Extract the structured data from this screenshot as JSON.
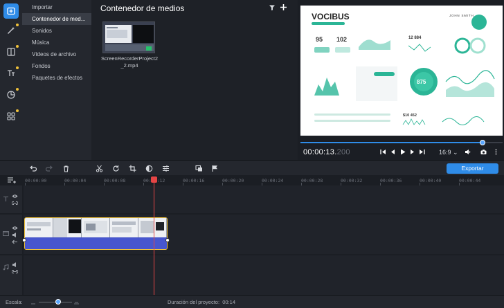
{
  "sidebar": {
    "tools": [
      {
        "name": "import-icon",
        "active": true,
        "dot": false
      },
      {
        "name": "magic-wand-icon",
        "active": false,
        "dot": true
      },
      {
        "name": "transitions-icon",
        "active": false,
        "dot": true
      },
      {
        "name": "titles-icon",
        "active": false,
        "dot": true
      },
      {
        "name": "stickers-icon",
        "active": false,
        "dot": true
      },
      {
        "name": "more-tools-icon",
        "active": false,
        "dot": true
      }
    ]
  },
  "categories": [
    {
      "label": "Importar"
    },
    {
      "label": "Contenedor de med..."
    },
    {
      "label": "Sonidos"
    },
    {
      "label": "Música"
    },
    {
      "label": "Vídeos de archivo"
    },
    {
      "label": "Fondos"
    },
    {
      "label": "Paquetes de efectos"
    }
  ],
  "mediabin": {
    "title": "Contenedor de medios",
    "clip_name_line1": "ScreenRecorderProject2",
    "clip_name_line2": "_2.mp4"
  },
  "preview": {
    "brand": "VOCIBUS",
    "author": "JOHN SMITH",
    "stat1": "95",
    "stat2": "102",
    "stat3": "12 884",
    "center_value": "875",
    "bottom_value": "$10 452",
    "timecode_main": "00:00:13.",
    "timecode_ms": "200",
    "aspect_ratio": "16:9",
    "progress": 0.9
  },
  "toolbar": {
    "export_label": "Exportar"
  },
  "ruler": {
    "ticks": [
      "00:00:00",
      "00:00:04",
      "00:00:08",
      "00:00:12",
      "00:00:16",
      "00:00:20",
      "00:00:24",
      "00:00:28",
      "00:00:32",
      "00:00:36",
      "00:00:40",
      "00:00:44"
    ]
  },
  "status": {
    "scale_label": "Escala:",
    "duration_label": "Duración del proyecto:",
    "duration_value": "00:14"
  },
  "colors": {
    "accent": "#2f8ce8",
    "clip_border": "#f0c23a",
    "playhead": "#e64545",
    "audio": "#4756cf"
  }
}
